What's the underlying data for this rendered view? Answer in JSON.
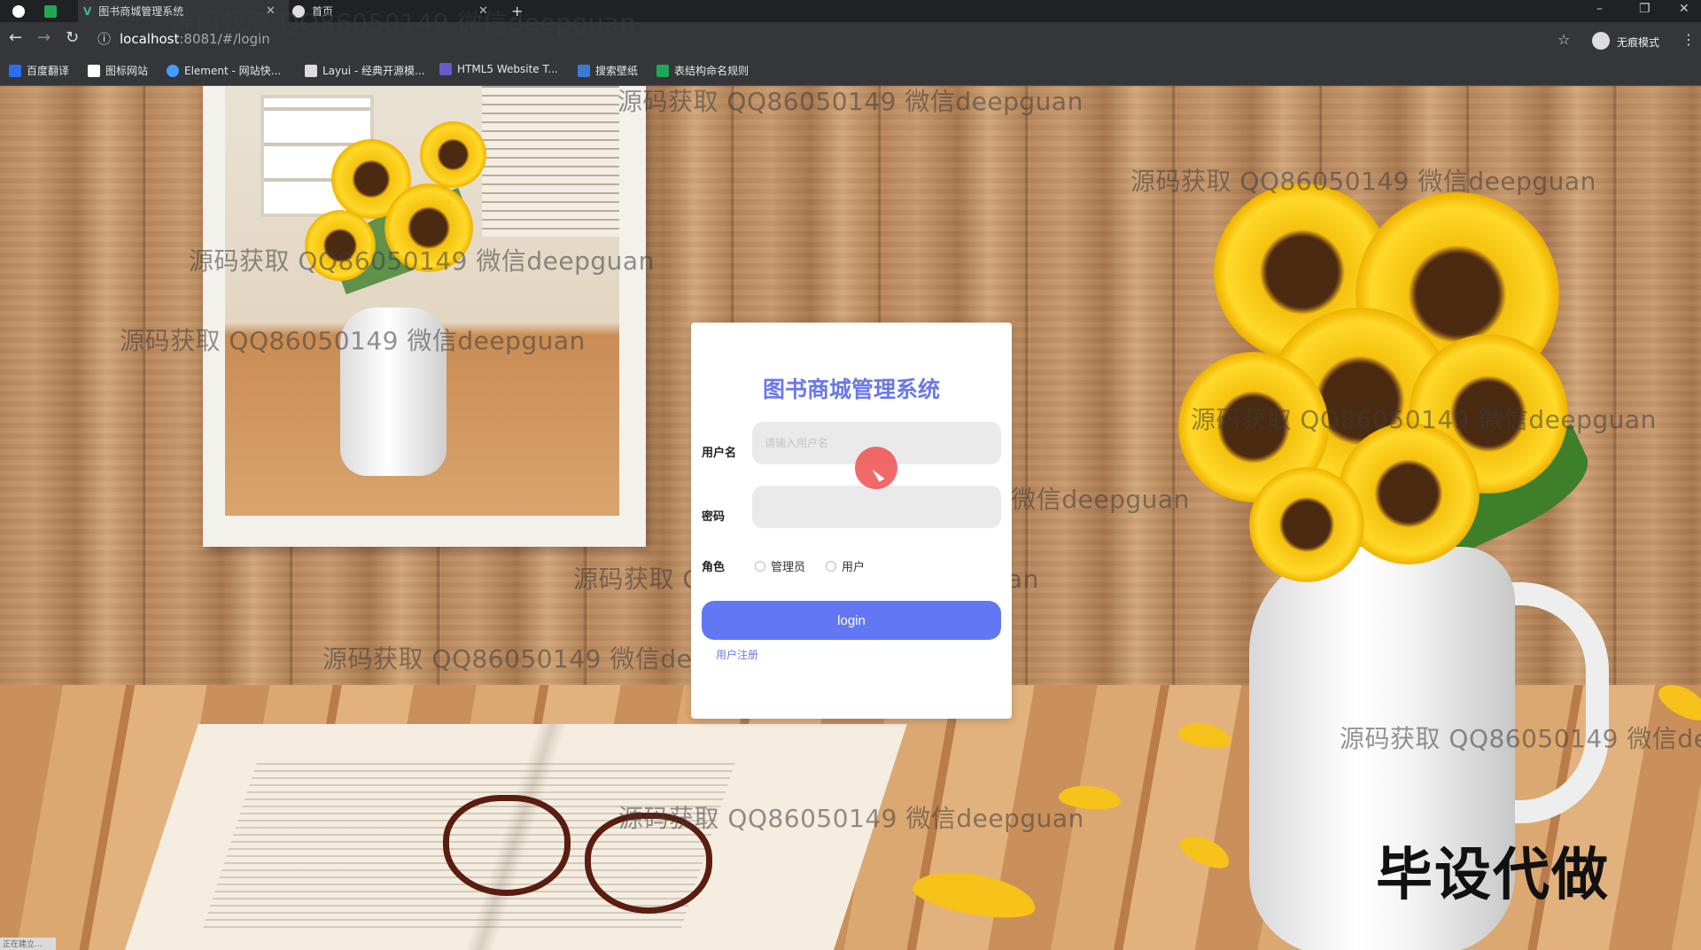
{
  "browser": {
    "tabs": [
      {
        "title": "图书商城管理系统",
        "active": true
      },
      {
        "title": "首页",
        "active": false
      }
    ],
    "new_tab_symbol": "+",
    "url_host": "localhost",
    "url_rest": ":8081/#/login",
    "profile_label": "无痕模式",
    "window_controls": [
      "–",
      "❐",
      "✕"
    ],
    "bookmarks": [
      {
        "label": "百度翻译",
        "icon": "translate-icon",
        "color": "#2b6ff0"
      },
      {
        "label": "图标网站",
        "icon": "flag-icon",
        "color": "#ffffff"
      },
      {
        "label": "Element - 网站快...",
        "icon": "element-icon",
        "color": "#409eff"
      },
      {
        "label": "Layui - 经典开源模...",
        "icon": "layui-icon",
        "color": "#dddddd"
      },
      {
        "label": "HTML5 Website T...",
        "icon": "html5-icon",
        "color": "#6a5acd"
      },
      {
        "label": "搜索壁纸",
        "icon": "wallpaper-icon",
        "color": "#3a7bd5"
      },
      {
        "label": "表结构命名规则",
        "icon": "doc-icon",
        "color": "#1fa855"
      }
    ]
  },
  "login": {
    "title": "图书商城管理系统",
    "username_label": "用户名",
    "username_placeholder": "请输入用户名",
    "password_label": "密码",
    "password_placeholder": "",
    "role_label": "角色",
    "roles": [
      "管理员",
      "用户"
    ],
    "submit_label": "login",
    "register_link": "用户注册"
  },
  "watermark_text": "源码获取 QQ86050149 微信deepguan",
  "overlay_tag": "毕设代做",
  "status_text": "正在建立..."
}
